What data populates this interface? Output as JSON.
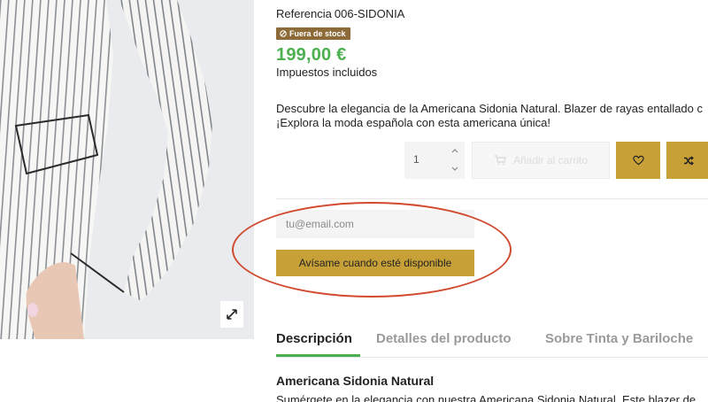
{
  "product": {
    "reference_label": "Referencia",
    "reference_value": "006-SIDONIA",
    "stock_badge": "Fuera de stock",
    "price": "199,00 €",
    "tax_note": "Impuestos incluidos",
    "description_line1": "Descubre la elegancia de la Americana Sidonia Natural. Blazer de rayas entallado c",
    "description_line2": "¡Explora la moda española con esta americana única!"
  },
  "cart": {
    "quantity": "1",
    "add_to_cart_label": "Añadir al carrito"
  },
  "notify": {
    "email_placeholder": "tu@email.com",
    "button_label": "Avísame cuando esté disponible"
  },
  "tabs": [
    {
      "label": "Descripción",
      "active": true
    },
    {
      "label": "Detalles del producto",
      "active": false
    },
    {
      "label": "Sobre Tinta y Bariloche",
      "active": false
    }
  ],
  "section": {
    "title": "Americana Sidonia Natural",
    "text": "Sumérgete en la elegancia con nuestra Americana Sidonia Natural. Este blazer de"
  },
  "icons": {
    "expand": "expand-icon",
    "stock": "ban-icon",
    "cart": "cart-icon",
    "wishlist": "heart-icon",
    "compare": "shuffle-icon"
  },
  "colors": {
    "accent_gold": "#c7a037",
    "price_green": "#4caf50",
    "badge_brown": "#8d6b38",
    "annotation_red": "#d14a2f"
  }
}
